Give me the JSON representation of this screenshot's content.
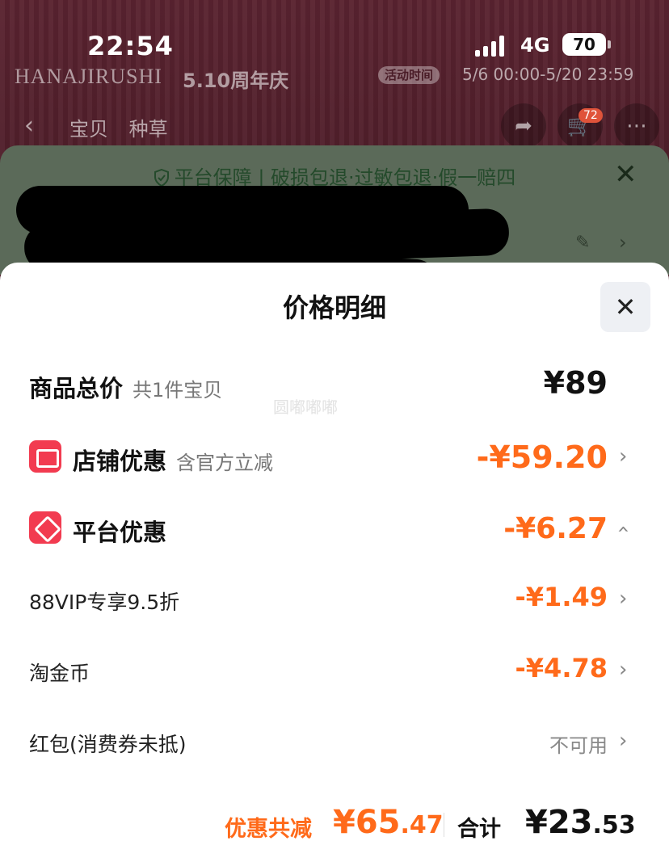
{
  "status_bar": {
    "time": "22:54",
    "network": "4G",
    "battery": "70"
  },
  "background": {
    "brand": "HANAJIRUSHI",
    "event": "5.10周年庆",
    "activity_tag": "活动时间",
    "activity_time": "5/6 00:00-5/20 23:59",
    "nav_tabs": [
      "宝贝",
      "种草"
    ],
    "cart_badge": "72"
  },
  "guarantee_sheet": {
    "text": "平台保障 | 破损包退·过敏包退·假一赔四"
  },
  "price_detail": {
    "title": "价格明细",
    "watermark": "圆嘟嘟嘟",
    "total_goods": {
      "label": "商品总价",
      "sub": "共1件宝贝",
      "amount": "¥89"
    },
    "store_discount": {
      "label": "店铺优惠",
      "sub": "含官方立减",
      "amount": "-¥59.20"
    },
    "platform_discount": {
      "label": "平台优惠",
      "amount": "-¥6.27"
    },
    "items": [
      {
        "label": "88VIP专享9.5折",
        "amount": "-¥1.49"
      },
      {
        "label": "淘金币",
        "amount": "-¥4.78"
      },
      {
        "label": "红包(消费券未抵)",
        "amount": "不可用"
      }
    ],
    "summary": {
      "save_label": "优惠共减",
      "save_amount_int": "¥65",
      "save_amount_dec": ".47",
      "total_label": "合计",
      "total_amount_int": "¥23",
      "total_amount_dec": ".53"
    }
  },
  "colors": {
    "accent": "#ff6a1a",
    "icon_red": "#f23b50"
  }
}
